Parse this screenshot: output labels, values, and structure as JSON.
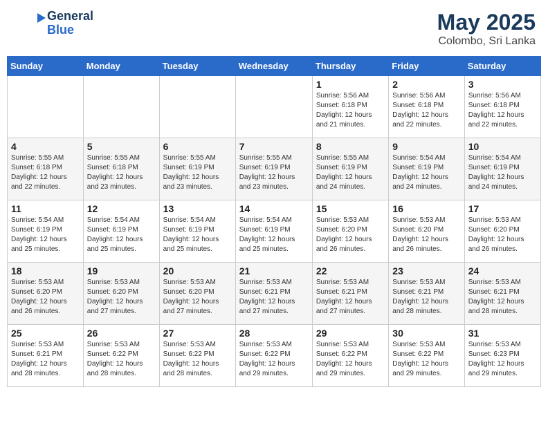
{
  "header": {
    "logo_line1": "General",
    "logo_line2": "Blue",
    "month": "May 2025",
    "location": "Colombo, Sri Lanka"
  },
  "weekdays": [
    "Sunday",
    "Monday",
    "Tuesday",
    "Wednesday",
    "Thursday",
    "Friday",
    "Saturday"
  ],
  "weeks": [
    [
      {
        "day": "",
        "info": ""
      },
      {
        "day": "",
        "info": ""
      },
      {
        "day": "",
        "info": ""
      },
      {
        "day": "",
        "info": ""
      },
      {
        "day": "1",
        "info": "Sunrise: 5:56 AM\nSunset: 6:18 PM\nDaylight: 12 hours\nand 21 minutes."
      },
      {
        "day": "2",
        "info": "Sunrise: 5:56 AM\nSunset: 6:18 PM\nDaylight: 12 hours\nand 22 minutes."
      },
      {
        "day": "3",
        "info": "Sunrise: 5:56 AM\nSunset: 6:18 PM\nDaylight: 12 hours\nand 22 minutes."
      }
    ],
    [
      {
        "day": "4",
        "info": "Sunrise: 5:55 AM\nSunset: 6:18 PM\nDaylight: 12 hours\nand 22 minutes."
      },
      {
        "day": "5",
        "info": "Sunrise: 5:55 AM\nSunset: 6:18 PM\nDaylight: 12 hours\nand 23 minutes."
      },
      {
        "day": "6",
        "info": "Sunrise: 5:55 AM\nSunset: 6:19 PM\nDaylight: 12 hours\nand 23 minutes."
      },
      {
        "day": "7",
        "info": "Sunrise: 5:55 AM\nSunset: 6:19 PM\nDaylight: 12 hours\nand 23 minutes."
      },
      {
        "day": "8",
        "info": "Sunrise: 5:55 AM\nSunset: 6:19 PM\nDaylight: 12 hours\nand 24 minutes."
      },
      {
        "day": "9",
        "info": "Sunrise: 5:54 AM\nSunset: 6:19 PM\nDaylight: 12 hours\nand 24 minutes."
      },
      {
        "day": "10",
        "info": "Sunrise: 5:54 AM\nSunset: 6:19 PM\nDaylight: 12 hours\nand 24 minutes."
      }
    ],
    [
      {
        "day": "11",
        "info": "Sunrise: 5:54 AM\nSunset: 6:19 PM\nDaylight: 12 hours\nand 25 minutes."
      },
      {
        "day": "12",
        "info": "Sunrise: 5:54 AM\nSunset: 6:19 PM\nDaylight: 12 hours\nand 25 minutes."
      },
      {
        "day": "13",
        "info": "Sunrise: 5:54 AM\nSunset: 6:19 PM\nDaylight: 12 hours\nand 25 minutes."
      },
      {
        "day": "14",
        "info": "Sunrise: 5:54 AM\nSunset: 6:19 PM\nDaylight: 12 hours\nand 25 minutes."
      },
      {
        "day": "15",
        "info": "Sunrise: 5:53 AM\nSunset: 6:20 PM\nDaylight: 12 hours\nand 26 minutes."
      },
      {
        "day": "16",
        "info": "Sunrise: 5:53 AM\nSunset: 6:20 PM\nDaylight: 12 hours\nand 26 minutes."
      },
      {
        "day": "17",
        "info": "Sunrise: 5:53 AM\nSunset: 6:20 PM\nDaylight: 12 hours\nand 26 minutes."
      }
    ],
    [
      {
        "day": "18",
        "info": "Sunrise: 5:53 AM\nSunset: 6:20 PM\nDaylight: 12 hours\nand 26 minutes."
      },
      {
        "day": "19",
        "info": "Sunrise: 5:53 AM\nSunset: 6:20 PM\nDaylight: 12 hours\nand 27 minutes."
      },
      {
        "day": "20",
        "info": "Sunrise: 5:53 AM\nSunset: 6:20 PM\nDaylight: 12 hours\nand 27 minutes."
      },
      {
        "day": "21",
        "info": "Sunrise: 5:53 AM\nSunset: 6:21 PM\nDaylight: 12 hours\nand 27 minutes."
      },
      {
        "day": "22",
        "info": "Sunrise: 5:53 AM\nSunset: 6:21 PM\nDaylight: 12 hours\nand 27 minutes."
      },
      {
        "day": "23",
        "info": "Sunrise: 5:53 AM\nSunset: 6:21 PM\nDaylight: 12 hours\nand 28 minutes."
      },
      {
        "day": "24",
        "info": "Sunrise: 5:53 AM\nSunset: 6:21 PM\nDaylight: 12 hours\nand 28 minutes."
      }
    ],
    [
      {
        "day": "25",
        "info": "Sunrise: 5:53 AM\nSunset: 6:21 PM\nDaylight: 12 hours\nand 28 minutes."
      },
      {
        "day": "26",
        "info": "Sunrise: 5:53 AM\nSunset: 6:22 PM\nDaylight: 12 hours\nand 28 minutes."
      },
      {
        "day": "27",
        "info": "Sunrise: 5:53 AM\nSunset: 6:22 PM\nDaylight: 12 hours\nand 28 minutes."
      },
      {
        "day": "28",
        "info": "Sunrise: 5:53 AM\nSunset: 6:22 PM\nDaylight: 12 hours\nand 29 minutes."
      },
      {
        "day": "29",
        "info": "Sunrise: 5:53 AM\nSunset: 6:22 PM\nDaylight: 12 hours\nand 29 minutes."
      },
      {
        "day": "30",
        "info": "Sunrise: 5:53 AM\nSunset: 6:22 PM\nDaylight: 12 hours\nand 29 minutes."
      },
      {
        "day": "31",
        "info": "Sunrise: 5:53 AM\nSunset: 6:23 PM\nDaylight: 12 hours\nand 29 minutes."
      }
    ]
  ]
}
